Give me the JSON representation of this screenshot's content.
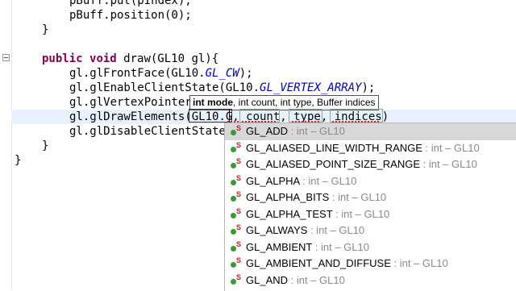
{
  "code_lines": [
    {
      "indent": 2,
      "segments": [
        {
          "t": "pBuff.put(pIndex);",
          "c": ""
        }
      ]
    },
    {
      "indent": 2,
      "segments": [
        {
          "t": "pBuff.position(0);",
          "c": ""
        }
      ]
    },
    {
      "indent": 1,
      "segments": [
        {
          "t": "}",
          "c": ""
        }
      ]
    },
    {
      "indent": 0,
      "segments": []
    },
    {
      "indent": 1,
      "segments": [
        {
          "t": "public",
          "c": "kw"
        },
        {
          "t": " ",
          "c": ""
        },
        {
          "t": "void",
          "c": "kw"
        },
        {
          "t": " draw(GL10 gl){",
          "c": ""
        }
      ]
    },
    {
      "indent": 2,
      "segments": [
        {
          "t": "gl.glFrontFace(GL10.",
          "c": ""
        },
        {
          "t": "GL_CW",
          "c": "const"
        },
        {
          "t": ");",
          "c": ""
        }
      ]
    },
    {
      "indent": 2,
      "segments": [
        {
          "t": "gl.glEnableClientState(GL10.",
          "c": ""
        },
        {
          "t": "GL_VERTEX_ARRAY",
          "c": "const"
        },
        {
          "t": ");",
          "c": ""
        }
      ]
    },
    {
      "indent": 2,
      "segments": [
        {
          "t": "gl.glVertexPointer",
          "c": ""
        }
      ]
    },
    {
      "indent": 2,
      "segments": [
        {
          "t": "gl.glDrawElements(GL10.G, count, type, indices)",
          "c": ""
        }
      ]
    },
    {
      "indent": 2,
      "segments": [
        {
          "t": "gl.glDisableClientState",
          "c": ""
        }
      ]
    },
    {
      "indent": 1,
      "segments": [
        {
          "t": "}",
          "c": ""
        }
      ]
    },
    {
      "indent": 0,
      "segments": [
        {
          "t": "}",
          "c": ""
        }
      ]
    }
  ],
  "param_hint": {
    "bold": "int mode",
    "rest": ", int count, int type, Buffer indices"
  },
  "completions": [
    {
      "name": "GL_ADD",
      "detail": " : int – GL10",
      "selected": true
    },
    {
      "name": "GL_ALIASED_LINE_WIDTH_RANGE",
      "detail": " : int – GL10",
      "selected": false
    },
    {
      "name": "GL_ALIASED_POINT_SIZE_RANGE",
      "detail": " : int – GL10",
      "selected": false
    },
    {
      "name": "GL_ALPHA",
      "detail": " : int – GL10",
      "selected": false
    },
    {
      "name": "GL_ALPHA_BITS",
      "detail": " : int – GL10",
      "selected": false
    },
    {
      "name": "GL_ALPHA_TEST",
      "detail": " : int – GL10",
      "selected": false
    },
    {
      "name": "GL_ALWAYS",
      "detail": " : int – GL10",
      "selected": false
    },
    {
      "name": "GL_AMBIENT",
      "detail": " : int – GL10",
      "selected": false
    },
    {
      "name": "GL_AMBIENT_AND_DIFFUSE",
      "detail": " : int – GL10",
      "selected": false
    },
    {
      "name": "GL_AND",
      "detail": " : int – GL10",
      "selected": false
    }
  ],
  "colors": {
    "keyword": "#7f0055",
    "constant": "#0000c0",
    "current_line": "#e8f2fe",
    "selected_item": "#d8d8d8"
  },
  "icons": {
    "gutter_fold": "fold-collapse-icon",
    "completion": "static-field-icon"
  }
}
